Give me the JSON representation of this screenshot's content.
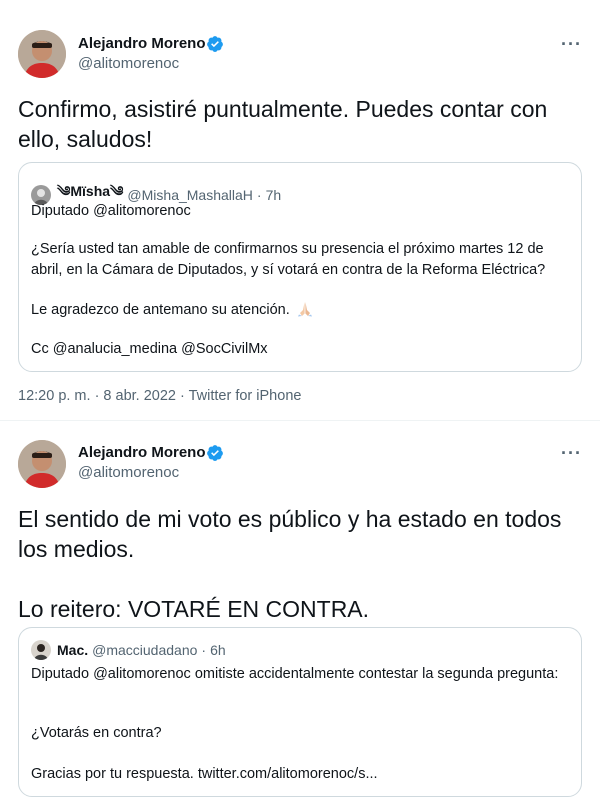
{
  "tweet1": {
    "author_name": "Alejandro Moreno",
    "author_handle": "@alitomorenoc",
    "more": "···",
    "text": "Confirmo, asistiré puntualmente. Puedes contar con ello, saludos!",
    "quote": {
      "name": "༄Mïsha༄",
      "handle": "@Misha_MashallaH",
      "dot": "·",
      "time": "7h",
      "line1": "Diputado @alitomorenoc",
      "line2": "¿Sería usted tan amable de confirmarnos su presencia el próximo martes 12 de abril, en la Cámara de Diputados, y  sí votará en contra de la Reforma Eléctrica?",
      "line3": "Le agradezco de antemano su atención.",
      "line4": "Cc @analucia_medina @SocCivilMx"
    },
    "meta": "12:20 p. m. · 8 abr. 2022 · Twitter for iPhone"
  },
  "tweet2": {
    "author_name": "Alejandro Moreno",
    "author_handle": "@alitomorenoc",
    "more": "···",
    "text": "El sentido de mi voto es público y ha estado en todos los medios.\n\nLo reitero: VOTARÉ EN CONTRA.",
    "quote": {
      "name": "Mac.",
      "handle": "@macciudadano",
      "dot": "·",
      "time": "6h",
      "line1": "Diputado @alitomorenoc omitiste accidentalmente contestar la segunda pregunta:",
      "line2": "¿Votarás en contra?",
      "line3": "Gracias por tu respuesta. twitter.com/alitomorenoc/s..."
    }
  },
  "colors": {
    "verified": "#1d9bf0",
    "secondary_text": "#536471",
    "border": "#cfd9de"
  }
}
